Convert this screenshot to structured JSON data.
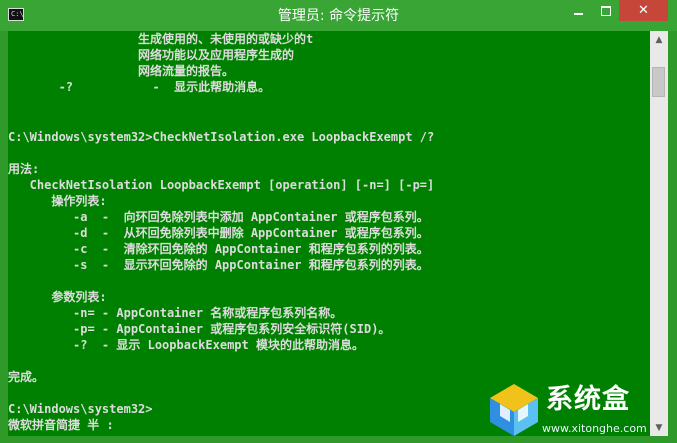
{
  "window": {
    "icon_text": "C:\\",
    "title": "管理员: 命令提示符",
    "minimize_glyph": "",
    "close_glyph": "✕"
  },
  "console": {
    "lines": [
      "                  生成使用的、未使用的或缺少的t",
      "                  网络功能以及应用程序生成的",
      "                  网络流量的报告。",
      "       -?           -  显示此帮助消息。",
      "",
      "",
      "C:\\Windows\\system32>CheckNetIsolation.exe LoopbackExempt /?",
      "",
      "用法:",
      "   CheckNetIsolation LoopbackExempt [operation] [-n=] [-p=]",
      "      操作列表:",
      "         -a  -  向环回免除列表中添加 AppContainer 或程序包系列。",
      "         -d  -  从环回免除列表中删除 AppContainer 或程序包系列。",
      "         -c  -  清除环回免除的 AppContainer 和程序包系列的列表。",
      "         -s  -  显示环回免除的 AppContainer 和程序包系列的列表。",
      "",
      "      参数列表:",
      "         -n= - AppContainer 名称或程序包系列名称。",
      "         -p= - AppContainer 或程序包系列安全标识符(SID)。",
      "         -?  - 显示 LoopbackExempt 模块的此帮助消息。",
      "",
      "完成。",
      "",
      "C:\\Windows\\system32>",
      "微软拼音简捷 半 :"
    ]
  },
  "scrollbar": {
    "up_glyph": "▲",
    "down_glyph": "▼"
  },
  "watermark": {
    "name": "系统盒",
    "url": "www.xitonghe.com"
  }
}
